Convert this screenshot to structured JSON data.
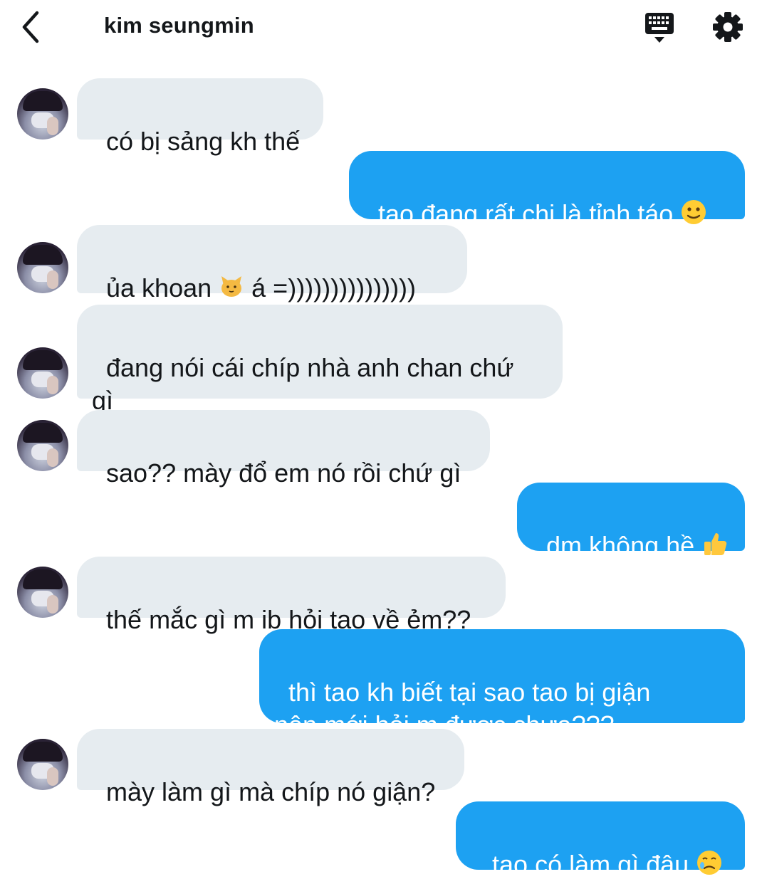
{
  "header": {
    "title": "kim seungmin",
    "back_icon": "chevron-left-icon",
    "keyboard_icon": "keyboard-icon",
    "settings_icon": "gear-icon"
  },
  "colors": {
    "sent_bubble": "#1da1f2",
    "received_bubble": "#e6ecf0",
    "text": "#14171a"
  },
  "messages": [
    {
      "direction": "received",
      "text": "có bị sảng kh thế"
    },
    {
      "direction": "sent",
      "text": "tao đang rất chi là tỉnh táo ",
      "emoji": "slightly-smiling-face"
    },
    {
      "direction": "received",
      "text": "ủa khoan ",
      "emoji": "cat-face",
      "text_after": " á =)))))))))))))))"
    },
    {
      "direction": "received",
      "text": "đang nói cái chíp nhà anh chan chứ\ngì"
    },
    {
      "direction": "received",
      "text": "sao?? mày đổ em nó rồi chứ gì"
    },
    {
      "direction": "sent",
      "text": "dm không hề ",
      "emoji": "thumbs-up"
    },
    {
      "direction": "received",
      "text": "thế mắc gì m ib hỏi tao về ẻm??"
    },
    {
      "direction": "sent",
      "text": "thì tao kh biết tại sao tao bị giận\nnên mới hỏi m được chưa???"
    },
    {
      "direction": "received",
      "text": "mày làm gì mà chíp nó giận?"
    },
    {
      "direction": "sent",
      "text": "tao có làm gì đâu ",
      "emoji": "face-holding-back-tears"
    }
  ]
}
